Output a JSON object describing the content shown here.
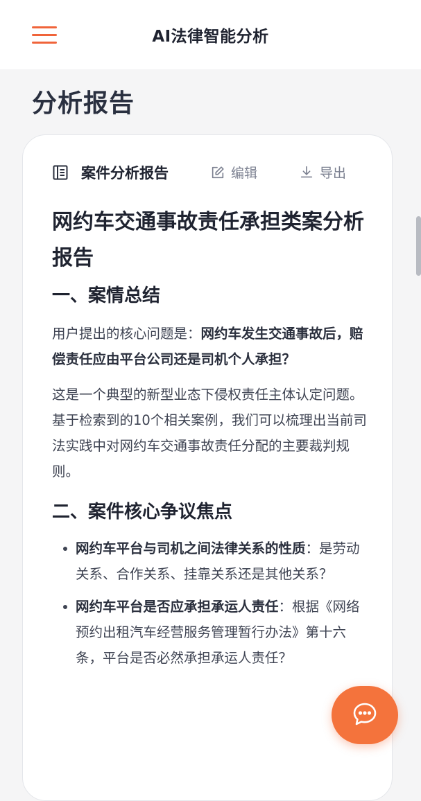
{
  "header": {
    "title": "AI法律智能分析",
    "menu_icon": "hamburger-menu-icon",
    "accent_color": "#f0643a"
  },
  "page": {
    "heading": "分析报告"
  },
  "report_card": {
    "title": "案件分析报告",
    "title_icon": "document-list-icon",
    "edit_label": "编辑",
    "edit_icon": "edit-pencil-icon",
    "export_label": "导出",
    "export_icon": "download-icon"
  },
  "report": {
    "doc_title": "网约车交通事故责任承担类案分析报告",
    "section1_heading": "一、案情总结",
    "p1_prefix": "用户提出的核心问题是：",
    "p1_bold": "网约车发生交通事故后，赔偿责任应由平台公司还是司机个人承担？",
    "p2": "这是一个典型的新型业态下侵权责任主体认定问题。基于检索到的10个相关案例，我们可以梳理出当前司法实践中对网约车交通事故责任分配的主要裁判规则。",
    "section2_heading": "二、案件核心争议焦点",
    "focus_items": [
      {
        "bold": "网约车平台与司机之间法律关系的性质",
        "text": "：是劳动关系、合作关系、挂靠关系还是其他关系？"
      },
      {
        "bold": "网约车平台是否应承担承运人责任",
        "text": "：根据《网络预约出租汽车经营服务管理暂行办法》第十六条，平台是否必然承担承运人责任？"
      }
    ]
  },
  "chat_fab": {
    "icon": "chat-bubble-icon",
    "color": "#f4733c"
  }
}
